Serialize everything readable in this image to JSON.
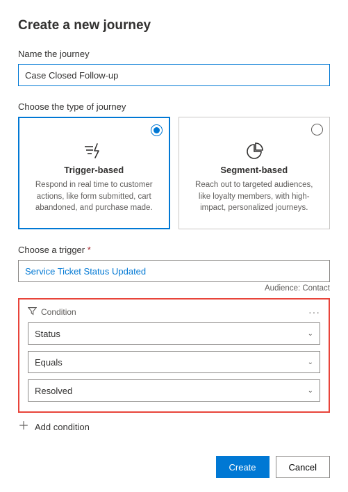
{
  "title": "Create a new journey",
  "name_field": {
    "label": "Name the journey",
    "value": "Case Closed Follow-up"
  },
  "type_section": {
    "label": "Choose the type of journey",
    "options": [
      {
        "title": "Trigger-based",
        "desc": "Respond in real time to customer actions, like form submitted, cart abandoned, and purchase made.",
        "selected": true
      },
      {
        "title": "Segment-based",
        "desc": "Reach out to targeted audiences, like loyalty members, with high-impact, personalized journeys.",
        "selected": false
      }
    ]
  },
  "trigger_section": {
    "label_text": "Choose a trigger ",
    "required_mark": "*",
    "value": "Service Ticket Status Updated",
    "audience_label": "Audience: Contact"
  },
  "condition": {
    "title": "Condition",
    "attribute": "Status",
    "operator": "Equals",
    "value": "Resolved"
  },
  "add_condition_label": "Add condition",
  "buttons": {
    "create": "Create",
    "cancel": "Cancel"
  }
}
